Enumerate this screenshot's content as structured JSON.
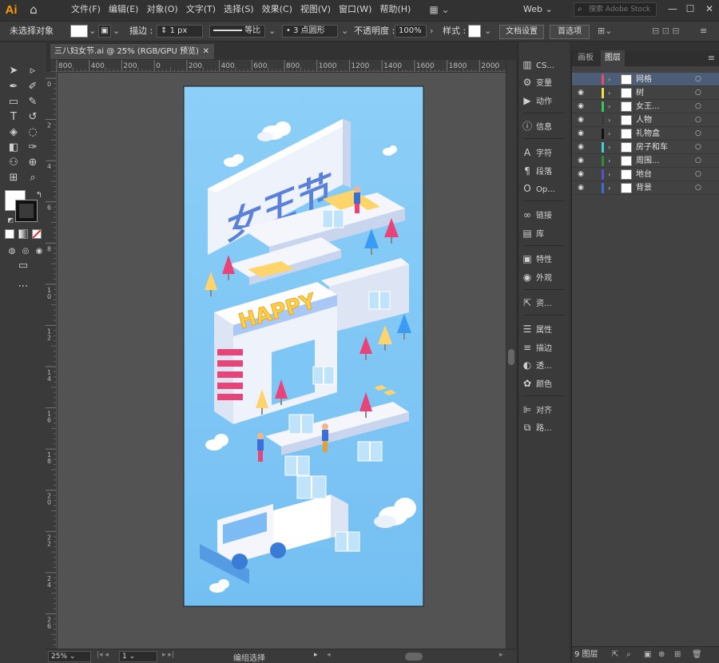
{
  "app": {
    "logo": "Ai",
    "workspace": "Web",
    "stock_search_placeholder": "搜索 Adobe Stock"
  },
  "menu": [
    "文件(F)",
    "编辑(E)",
    "对象(O)",
    "文字(T)",
    "选择(S)",
    "效果(C)",
    "视图(V)",
    "窗口(W)",
    "帮助(H)"
  ],
  "controlbar": {
    "selection_status": "未选择对象",
    "stroke_label": "描边 :",
    "stroke_value": "1 px",
    "profile_label": "等比",
    "brush_label": "3 点圆形",
    "opacity_label": "不透明度 :",
    "opacity_value": "100%",
    "style_label": "样式 :",
    "doc_setup_button": "文档设置",
    "preferences_button": "首选项"
  },
  "document": {
    "tab_title": "三八妇女节.ai @ 25% (RGB/GPU 预览)",
    "ruler_top": [
      "800",
      "400",
      "200",
      "0",
      "200",
      "400",
      "600",
      "800",
      "1000",
      "1200",
      "1400",
      "1600",
      "1800",
      "2000"
    ],
    "ruler_left": [
      "0",
      "2",
      "4",
      "6",
      "8",
      "10",
      "12",
      "14",
      "16",
      "18",
      "20",
      "22",
      "24",
      "26"
    ],
    "zoom": "25%",
    "artboard_number": "1",
    "status": "编组选择"
  },
  "artwork": {
    "headline": "女王节",
    "sign": "HAPPY",
    "colors": {
      "sky": "#7dc6f5",
      "pink": "#e8447a",
      "yellow": "#ffd56b",
      "white": "#f4f6fb",
      "blue": "#3a7bd5"
    }
  },
  "panels_collapsed": [
    {
      "icon": "color-guide-icon",
      "label": "CS..."
    },
    {
      "icon": "variables-icon",
      "label": "变量"
    },
    {
      "icon": "actions-icon",
      "label": "动作"
    },
    {
      "icon": "info-icon",
      "label": "信息"
    },
    {
      "icon": "character-icon",
      "label": "字符"
    },
    {
      "icon": "paragraph-icon",
      "label": "段落"
    },
    {
      "icon": "opentype-icon",
      "label": "Op..."
    },
    {
      "icon": "links-icon",
      "label": "链接"
    },
    {
      "icon": "libraries-icon",
      "label": "库"
    },
    {
      "icon": "attributes-icon",
      "label": "特性"
    },
    {
      "icon": "appearance-icon",
      "label": "外观"
    },
    {
      "icon": "asset-export-icon",
      "label": "资..."
    },
    {
      "icon": "properties-icon",
      "label": "属性"
    },
    {
      "icon": "stroke-icon",
      "label": "描边"
    },
    {
      "icon": "transparency-icon",
      "label": "透..."
    },
    {
      "icon": "color-icon",
      "label": "颜色"
    },
    {
      "icon": "align-icon",
      "label": "对齐"
    },
    {
      "icon": "pathfinder-icon",
      "label": "路..."
    }
  ],
  "layers": {
    "tabs": [
      "画板",
      "图层"
    ],
    "rows": [
      {
        "name": "网格",
        "color": "#e84a6b",
        "visible": false,
        "selected": true
      },
      {
        "name": "树",
        "color": "#f2e14a",
        "visible": true,
        "selected": false
      },
      {
        "name": "女王...",
        "color": "#35c759",
        "visible": true,
        "selected": false
      },
      {
        "name": "人物",
        "color": "#3a3a3a",
        "visible": true,
        "selected": false
      },
      {
        "name": "礼物盒",
        "color": "#111111",
        "visible": true,
        "selected": false
      },
      {
        "name": "房子和车",
        "color": "#3fd1d1",
        "visible": true,
        "selected": false
      },
      {
        "name": "周围...",
        "color": "#2f8a3a",
        "visible": true,
        "selected": false
      },
      {
        "name": "地台",
        "color": "#5a4fcf",
        "visible": true,
        "selected": false
      },
      {
        "name": "背景",
        "color": "#3b6fd8",
        "visible": true,
        "selected": false
      }
    ],
    "count_label": "9 图层"
  }
}
